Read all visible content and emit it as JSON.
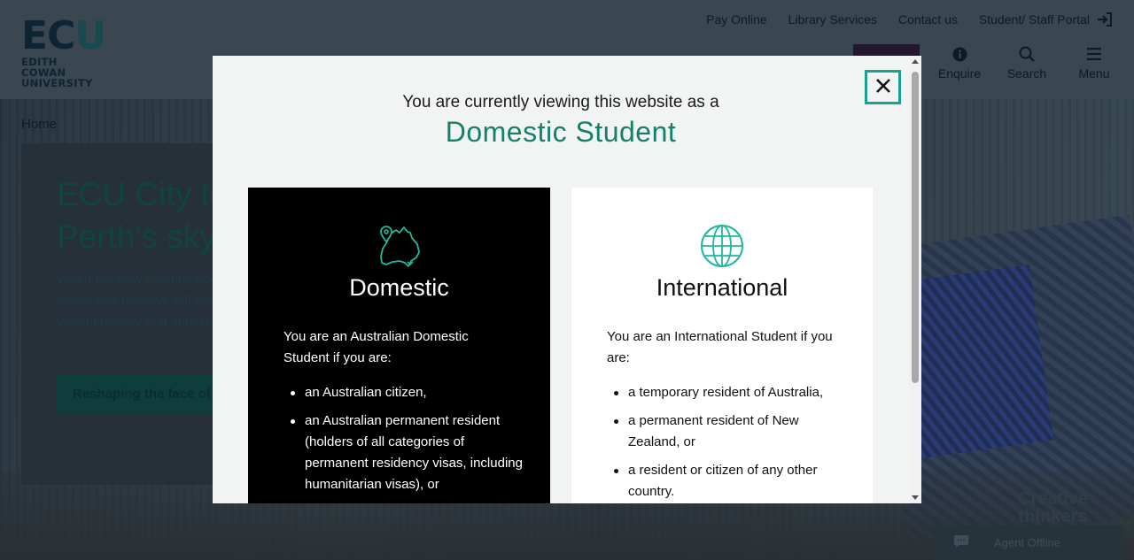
{
  "header": {
    "logo": {
      "mark_left": "EC",
      "mark_u": "U",
      "line1": "EDITH COWAN",
      "line2": "UNIVERSITY"
    },
    "top_links": [
      "Pay Online",
      "Library Services",
      "Contact us"
    ],
    "portal_label": "Student/ Staff Portal",
    "actions": [
      {
        "label": "Enquire",
        "icon": "info-icon"
      },
      {
        "label": "Search",
        "icon": "search-icon"
      },
      {
        "label": "Menu",
        "icon": "hamburger-icon"
      }
    ]
  },
  "hero": {
    "breadcrumb": "Home",
    "title": "ECU City to light up Perth's skyline",
    "text": "When the new campus opens, its LED façade and immersive displays will bring Perth's CBD to life in a vibrant display that stands out.",
    "button_label": "Reshaping the face of Perth",
    "tagline_line1": "Creative",
    "tagline_line2": "thinkers"
  },
  "chat": {
    "label": "Agent Offline",
    "icon": "chat-icon"
  },
  "modal": {
    "intro": "You are currently viewing this website as a",
    "current": "Domestic Student",
    "close_icon": "close-icon",
    "domestic": {
      "icon": "australia-map-pin-icon",
      "title": "Domestic",
      "desc": "You are an Australian Domestic Student if you are:",
      "items": [
        "an Australian citizen,",
        "an Australian permanent resident (holders of all categories of permanent residency visas, including humanitarian visas), or"
      ]
    },
    "international": {
      "icon": "globe-icon",
      "title": "International",
      "desc": "You are an International Student if you are:",
      "items": [
        "a temporary resident of Australia,",
        "a permanent resident of New Zealand, or",
        "a resident or citizen of any other country."
      ]
    }
  },
  "colors": {
    "accent_green": "#17806a",
    "close_border": "#1aa191",
    "domestic_panel": "#000000",
    "international_panel": "#ffffff"
  }
}
